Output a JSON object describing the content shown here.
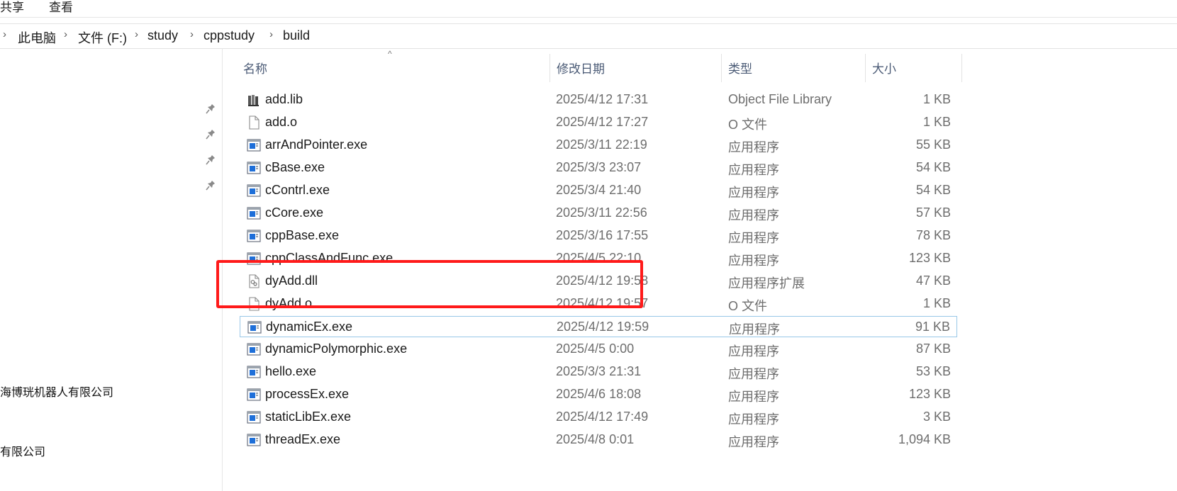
{
  "ribbon": {
    "share_label": "共享",
    "view_label": "查看"
  },
  "breadcrumb": {
    "items": [
      "此电脑",
      "文件 (F:)",
      "study",
      "cppstudy",
      "build"
    ],
    "separator": "›"
  },
  "nav_pane": {
    "pinned_icon": "pin-icon",
    "items": [
      "海博珖机器人有限公司",
      "有限公司"
    ]
  },
  "columns": {
    "name": "名称",
    "date": "修改日期",
    "type": "类型",
    "size": "大小"
  },
  "files": [
    {
      "name": "add.lib",
      "date": "2025/4/12 17:31",
      "type": "Object File Library",
      "size": "1 KB",
      "icon": "library-icon"
    },
    {
      "name": "add.o",
      "date": "2025/4/12 17:27",
      "type": "O 文件",
      "size": "1 KB",
      "icon": "file-icon"
    },
    {
      "name": "arrAndPointer.exe",
      "date": "2025/3/11 22:19",
      "type": "应用程序",
      "size": "55 KB",
      "icon": "exe-icon"
    },
    {
      "name": "cBase.exe",
      "date": "2025/3/3 23:07",
      "type": "应用程序",
      "size": "54 KB",
      "icon": "exe-icon"
    },
    {
      "name": "cContrl.exe",
      "date": "2025/3/4 21:40",
      "type": "应用程序",
      "size": "54 KB",
      "icon": "exe-icon"
    },
    {
      "name": "cCore.exe",
      "date": "2025/3/11 22:56",
      "type": "应用程序",
      "size": "57 KB",
      "icon": "exe-icon"
    },
    {
      "name": "cppBase.exe",
      "date": "2025/3/16 17:55",
      "type": "应用程序",
      "size": "78 KB",
      "icon": "exe-icon"
    },
    {
      "name": "cppClassAndFunc.exe",
      "date": "2025/4/5 22:10",
      "type": "应用程序",
      "size": "123 KB",
      "icon": "exe-icon"
    },
    {
      "name": "dyAdd.dll",
      "date": "2025/4/12 19:58",
      "type": "应用程序扩展",
      "size": "47 KB",
      "icon": "dll-icon"
    },
    {
      "name": "dyAdd.o",
      "date": "2025/4/12 19:57",
      "type": "O 文件",
      "size": "1 KB",
      "icon": "file-icon"
    },
    {
      "name": "dynamicEx.exe",
      "date": "2025/4/12 19:59",
      "type": "应用程序",
      "size": "91 KB",
      "icon": "exe-icon",
      "selected": true
    },
    {
      "name": "dynamicPolymorphic.exe",
      "date": "2025/4/5 0:00",
      "type": "应用程序",
      "size": "87 KB",
      "icon": "exe-icon"
    },
    {
      "name": "hello.exe",
      "date": "2025/3/3 21:31",
      "type": "应用程序",
      "size": "53 KB",
      "icon": "exe-icon"
    },
    {
      "name": "processEx.exe",
      "date": "2025/4/6 18:08",
      "type": "应用程序",
      "size": "123 KB",
      "icon": "exe-icon"
    },
    {
      "name": "staticLibEx.exe",
      "date": "2025/4/12 17:49",
      "type": "应用程序",
      "size": "3 KB",
      "icon": "exe-icon"
    },
    {
      "name": "threadEx.exe",
      "date": "2025/4/8 0:01",
      "type": "应用程序",
      "size": "1,094 KB",
      "icon": "exe-icon"
    }
  ],
  "colors": {
    "highlight_box": "#ff1a1a",
    "selection_border": "#99c8e8",
    "exe_icon_blue": "#1e6fd9"
  }
}
